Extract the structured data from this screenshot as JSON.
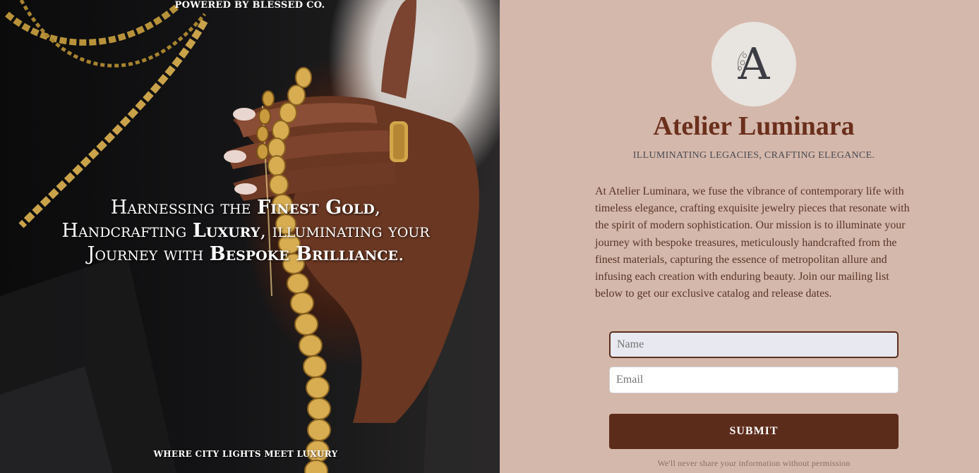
{
  "hero": {
    "top_label": "POWERED BY BLESSED CO.",
    "headline_1": "Harnessing the ",
    "headline_bold_1": "Finest Gold",
    "headline_2": ",",
    "headline_3": "Handcrafting ",
    "headline_bold_2": "Luxury",
    "headline_4": ", illuminating your",
    "headline_5": "Journey with ",
    "headline_bold_3": "Bespoke Brilliance",
    "headline_6": ".",
    "bottom_label": "WHERE CITY LIGHTS MEET LUXURY"
  },
  "brand": {
    "logo_letter": "A",
    "name": "Atelier Luminara",
    "tagline": "ILLUMINATING LEGACIES, CRAFTING ELEGANCE.",
    "description": "At Atelier Luminara, we fuse the vibrance of contemporary life with timeless elegance, crafting exquisite jewelry pieces that resonate with the spirit of modern sophistication. Our mission is to illuminate your journey with bespoke treasures, meticulously handcrafted from the finest materials, capturing the essence of metropolitan allure and infusing each creation with enduring beauty. Join our mailing list below to get our exclusive catalog and release dates."
  },
  "form": {
    "name_placeholder": "Name",
    "name_value": "",
    "email_placeholder": "Email",
    "email_value": "",
    "submit_label": "SUBMIT",
    "privacy_note": "We'll never share your information without permission"
  },
  "colors": {
    "panel_bg": "#d4b8ab",
    "brand": "#6b2f1c",
    "button": "#5c2c1b"
  }
}
